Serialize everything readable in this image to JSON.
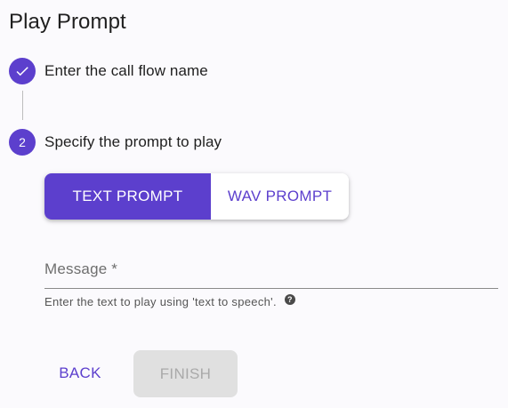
{
  "page": {
    "title": "Play Prompt"
  },
  "stepper": {
    "steps": [
      {
        "label": "Enter the call flow name",
        "state": "completed",
        "icon": "check-icon"
      },
      {
        "label": "Specify the prompt to play",
        "state": "active",
        "number": "2"
      }
    ]
  },
  "prompt_type": {
    "options": [
      {
        "label": "TEXT PROMPT",
        "selected": true
      },
      {
        "label": "WAV PROMPT",
        "selected": false
      }
    ]
  },
  "message_field": {
    "label": "Message *",
    "value": "",
    "helper_text": "Enter the text to play using 'text to speech'.",
    "help_icon": "help-circle-icon"
  },
  "actions": {
    "back_label": "BACK",
    "finish_label": "FINISH",
    "finish_disabled": true
  },
  "colors": {
    "accent": "#5c3fcd",
    "background": "#fbfafd",
    "disabled_bg": "#e0e0e0",
    "disabled_text": "#a9a9a9"
  }
}
